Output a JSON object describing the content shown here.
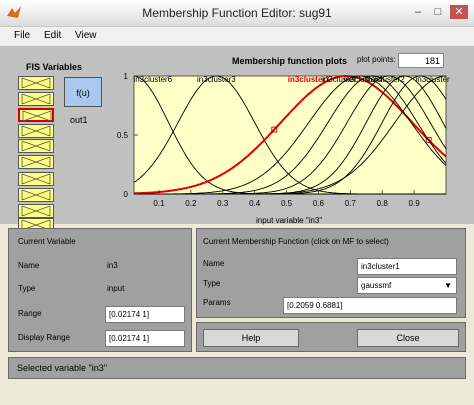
{
  "window": {
    "title": "Membership Function Editor: sug91"
  },
  "menu": [
    "File",
    "Edit",
    "View"
  ],
  "fis": {
    "title": "FIS Variables",
    "output_box": "f(u)",
    "output_label": "out1"
  },
  "plot": {
    "title": "Membership function plots",
    "points_label": "plot points:",
    "points_value": "181",
    "xlabel": "input variable \"in3\"",
    "xticks": [
      "0.1",
      "0.2",
      "0.3",
      "0.4",
      "0.5",
      "0.6",
      "0.7",
      "0.8",
      "0.9"
    ],
    "yticks": [
      "1",
      "0.5",
      "0"
    ],
    "labels": [
      "in3cluster6",
      "in3cluster3",
      "in3cluster1",
      "in3cluster",
      "in3cluster4",
      "in3cluster2",
      "in3cluster5"
    ]
  },
  "current_variable": {
    "title": "Current Variable",
    "name_label": "Name",
    "name_value": "in3",
    "type_label": "Type",
    "type_value": "input",
    "range_label": "Range",
    "range_value": "[0.02174 1]",
    "display_range_label": "Display Range",
    "display_range_value": "[0.02174 1]"
  },
  "current_mf": {
    "title": "Current Membership Function (click on MF to select)",
    "name_label": "Name",
    "name_value": "in3cluster1",
    "type_label": "Type",
    "type_value": "gaussmf",
    "params_label": "Params",
    "params_value": "[0.2059 0.6881]"
  },
  "buttons": {
    "help": "Help",
    "close": "Close"
  },
  "status": "Selected variable \"in3\"",
  "colors": {
    "plot_bg": "#ffffc8",
    "selected_mf": "#e00000",
    "fis_box": "#ffff80",
    "output_box": "#a8c8f0"
  }
}
